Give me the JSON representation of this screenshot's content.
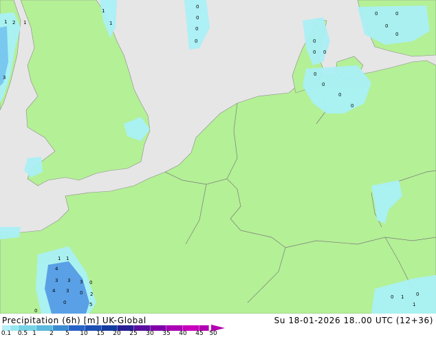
{
  "title": "Precipitation (6h) [m]  UK-Global",
  "valid_time": "Su 18-01-2026 18..00 UTC (12+36)",
  "legend": {
    "ticks": [
      "0.1",
      "0.5",
      "1",
      "2",
      "5",
      "10",
      "15",
      "20",
      "25",
      "30",
      "35",
      "40",
      "45",
      "50"
    ],
    "colors": [
      "#b4f0fa",
      "#96e6f0",
      "#78d2e6",
      "#5ab9dc",
      "#3c8cd2",
      "#2864c8",
      "#1e50b4",
      "#143ca0",
      "#281e96",
      "#5a0fa0",
      "#8200aa",
      "#aa00b4",
      "#c800be",
      "#b400b4"
    ]
  },
  "colors": {
    "sea": "#e6e6e6",
    "land": "#b4f096",
    "border": "#999999",
    "light_precip": "#aaf0f5",
    "heavy_precip": "#5aa0e6"
  },
  "map_labels": [
    {
      "id": "uk-w1",
      "text": "1"
    },
    {
      "id": "uk-w2",
      "text": "2"
    },
    {
      "id": "uk-w3",
      "text": "1"
    },
    {
      "id": "uk-n1",
      "text": "1"
    },
    {
      "id": "uk-n2",
      "text": "1"
    },
    {
      "id": "uk-s1",
      "text": "3"
    },
    {
      "id": "nl-1",
      "text": "0"
    },
    {
      "id": "nl-2",
      "text": "0"
    },
    {
      "id": "nl-3",
      "text": "0"
    },
    {
      "id": "nl-4",
      "text": "0"
    },
    {
      "id": "dk-1",
      "text": "0"
    },
    {
      "id": "dk-2",
      "text": "0"
    },
    {
      "id": "dk-3",
      "text": "0"
    },
    {
      "id": "dk-4",
      "text": "0"
    },
    {
      "id": "dk-5",
      "text": "0"
    },
    {
      "id": "dk-6",
      "text": "0"
    },
    {
      "id": "dk-7",
      "text": "0"
    },
    {
      "id": "se-1",
      "text": "0"
    },
    {
      "id": "se-2",
      "text": "0"
    },
    {
      "id": "se-3",
      "text": "0"
    },
    {
      "id": "se-4",
      "text": "0"
    },
    {
      "id": "bay-1",
      "text": "1"
    },
    {
      "id": "bay-2",
      "text": "1"
    },
    {
      "id": "bay-3",
      "text": "4"
    },
    {
      "id": "bay-4",
      "text": "3"
    },
    {
      "id": "bay-5",
      "text": "3"
    },
    {
      "id": "bay-6",
      "text": "3"
    },
    {
      "id": "bay-7",
      "text": "0"
    },
    {
      "id": "bay-8",
      "text": "4"
    },
    {
      "id": "bay-9",
      "text": "3"
    },
    {
      "id": "bay-10",
      "text": "0"
    },
    {
      "id": "bay-11",
      "text": "2"
    },
    {
      "id": "bay-12",
      "text": "0"
    },
    {
      "id": "bay-13",
      "text": "5"
    },
    {
      "id": "bay-14",
      "text": "0"
    },
    {
      "id": "alp-1",
      "text": "0"
    },
    {
      "id": "alp-2",
      "text": "1"
    },
    {
      "id": "alp-3",
      "text": "0"
    },
    {
      "id": "alp-4",
      "text": "1"
    }
  ]
}
